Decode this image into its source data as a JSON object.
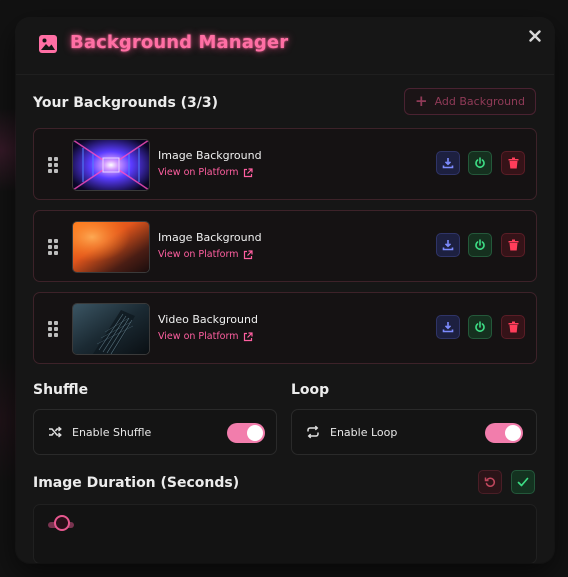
{
  "header": {
    "title": "Background Manager",
    "icon": "image-icon",
    "close_icon": "close-icon",
    "title_color": "#ff6fa4"
  },
  "backgrounds": {
    "heading": "Your Backgrounds (3/3)",
    "add_button_label": "Add Background",
    "items": [
      {
        "name": "Image Background",
        "link_label": "View on Platform",
        "thumb": "neon-corridor"
      },
      {
        "name": "Image Background",
        "link_label": "View on Platform",
        "thumb": "orange-gradient"
      },
      {
        "name": "Video Background",
        "link_label": "View on Platform",
        "thumb": "dark-building"
      }
    ]
  },
  "shuffle": {
    "heading": "Shuffle",
    "label": "Enable Shuffle",
    "enabled": true
  },
  "loop": {
    "heading": "Loop",
    "label": "Enable Loop",
    "enabled": true
  },
  "duration": {
    "heading": "Image Duration (Seconds)"
  },
  "colors": {
    "accent": "#ff5fa0",
    "toggle_on": "#f27dac",
    "download": "#6d7cf0",
    "power": "#3ddc84",
    "delete": "#ff3d5a"
  }
}
